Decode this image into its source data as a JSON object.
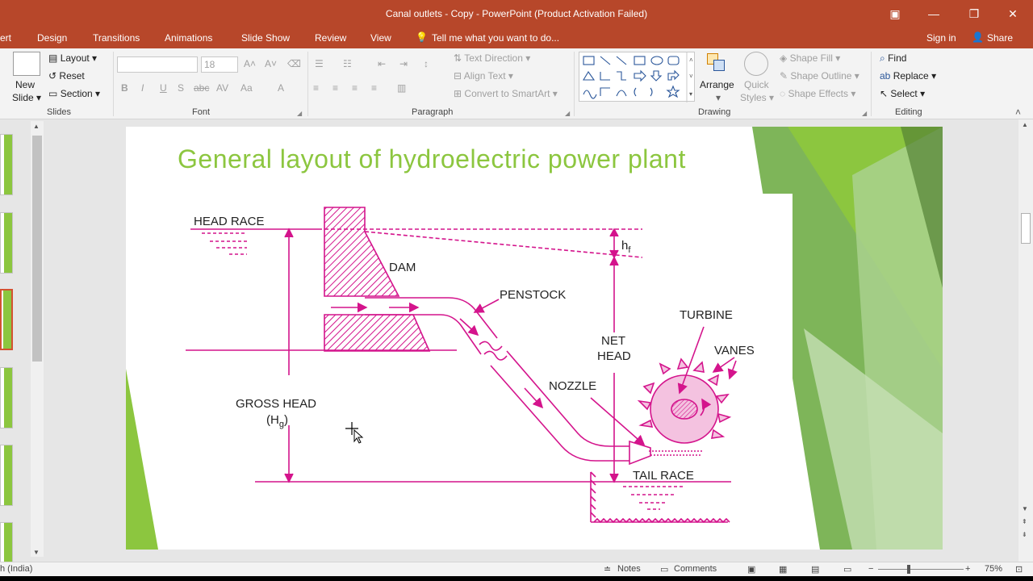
{
  "window": {
    "title": "Canal outlets - Copy - PowerPoint (Product Activation Failed)",
    "icons": [
      "ribbon-display-icon",
      "minimize-icon",
      "restore-icon",
      "close-icon"
    ]
  },
  "tabs": [
    "ert",
    "Design",
    "Transitions",
    "Animations",
    "Slide Show",
    "Review",
    "View"
  ],
  "tell_me": "Tell me what you want to do...",
  "sign_in": "Sign in",
  "share": "Share",
  "ribbon": {
    "slides": {
      "new_slide": "New",
      "new_slide_2": "Slide",
      "layout": "Layout",
      "reset": "Reset",
      "section": "Section",
      "label": "Slides"
    },
    "font": {
      "font_size": "18",
      "label": "Font"
    },
    "paragraph": {
      "text_direction": "Text Direction",
      "align_text": "Align Text",
      "convert_smartart": "Convert to SmartArt",
      "label": "Paragraph"
    },
    "drawing": {
      "arrange": "Arrange",
      "quick_styles": "Quick",
      "quick_styles_2": "Styles",
      "shape_fill": "Shape Fill",
      "shape_outline": "Shape Outline",
      "shape_effects": "Shape Effects",
      "label": "Drawing"
    },
    "editing": {
      "find": "Find",
      "replace": "Replace",
      "select": "Select",
      "label": "Editing"
    }
  },
  "slide": {
    "title": "General layout of hydroelectric power plant",
    "labels": {
      "head_race": "HEAD RACE",
      "dam": "DAM",
      "penstock": "PENSTOCK",
      "turbine": "TURBINE",
      "vanes": "VANES",
      "net_head_1": "NET",
      "net_head_2": "HEAD",
      "nozzle": "NOZZLE",
      "gross_head": "GROSS HEAD",
      "hg": "(H",
      "hg_sub": "g",
      "hg_close": ")",
      "hf": "h",
      "hf_sub": "f",
      "tail_race": "TAIL RACE"
    }
  },
  "status": {
    "language": "h (India)",
    "notes": "Notes",
    "comments": "Comments",
    "zoom": "75%"
  },
  "colors": {
    "accent": "#b7472a",
    "title_green": "#8cc63f",
    "diagram_magenta": "#d4148c"
  }
}
